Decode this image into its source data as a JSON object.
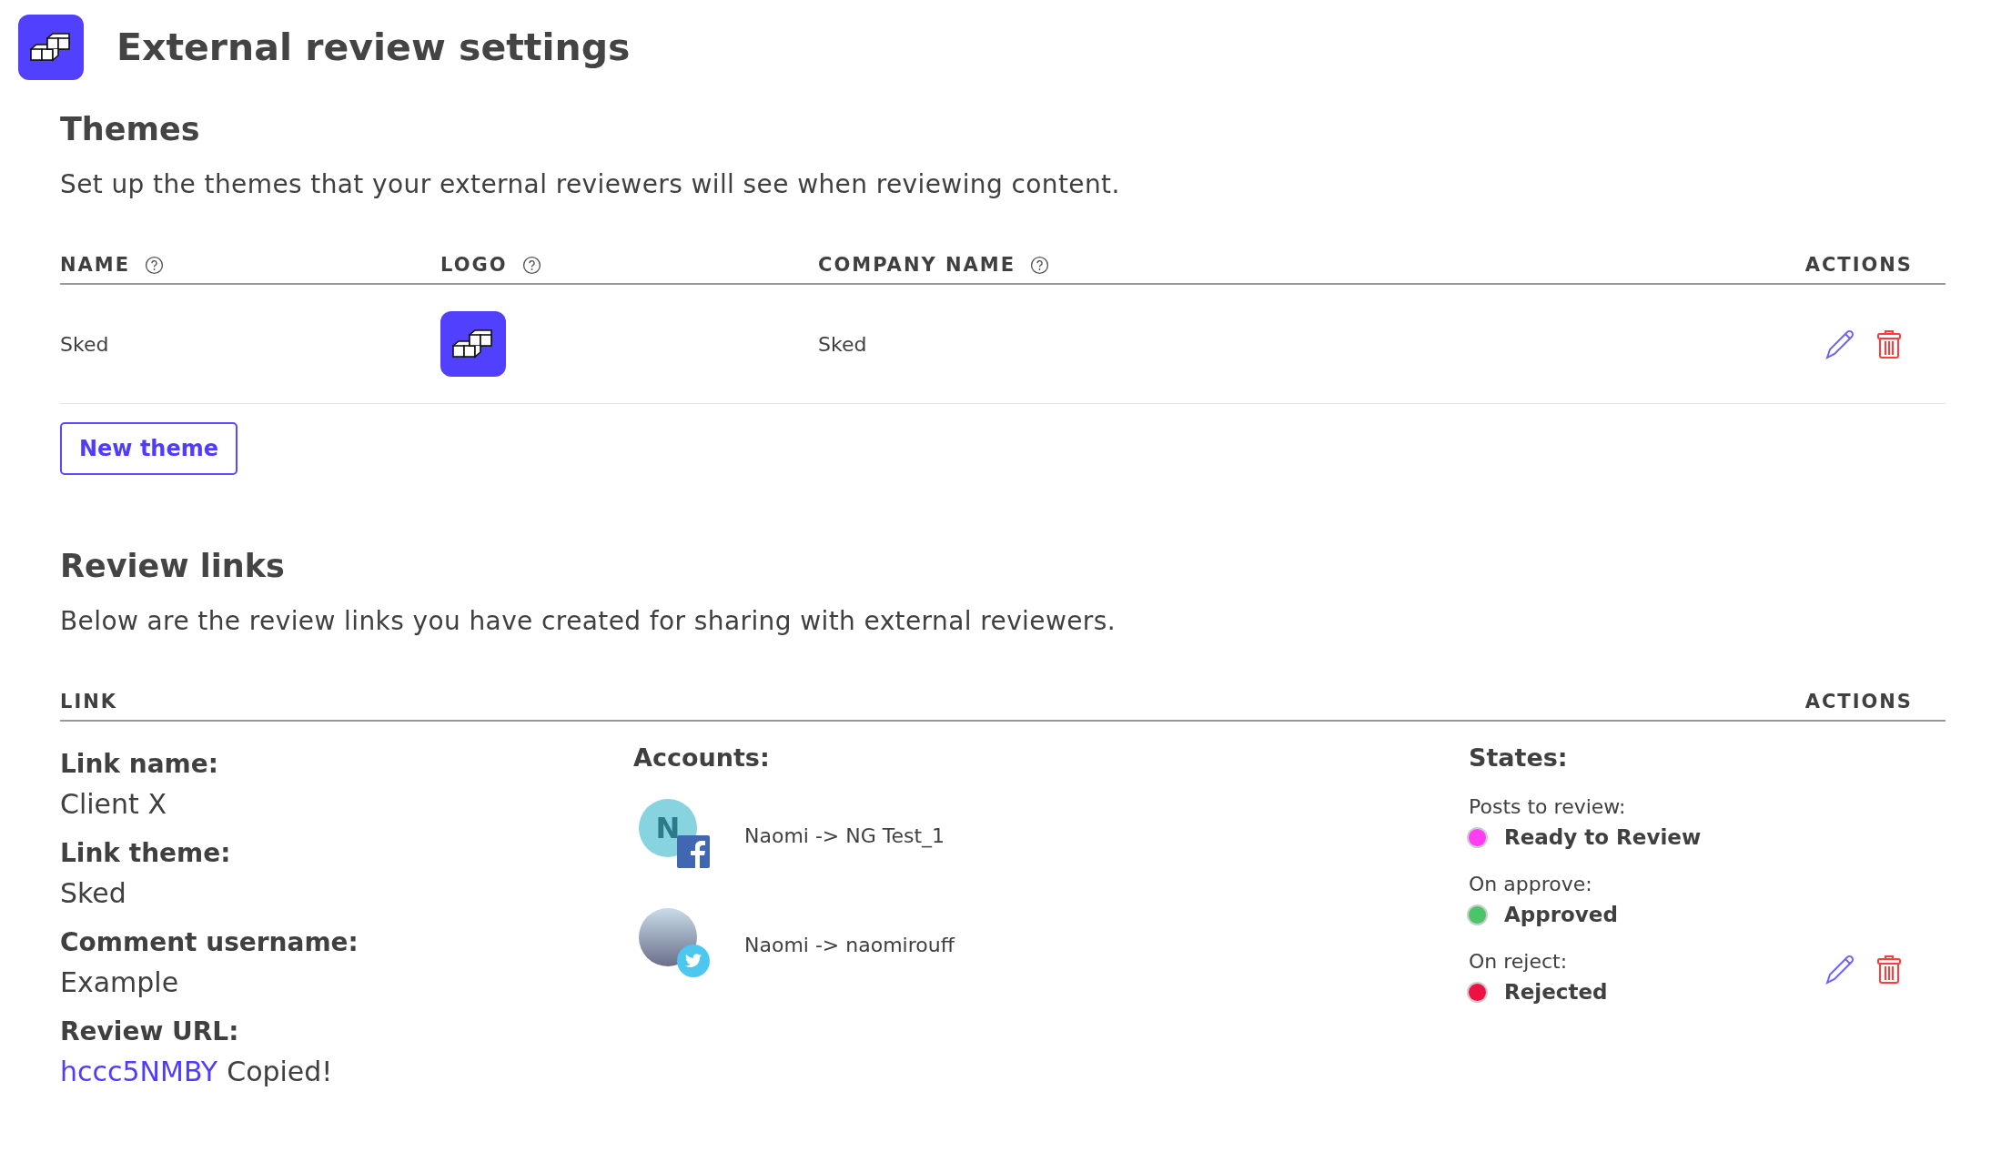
{
  "page": {
    "title": "External review settings"
  },
  "themes": {
    "title": "Themes",
    "description": "Set up the themes that your external reviewers will see when reviewing content.",
    "columns": [
      {
        "label": "NAME",
        "help": true
      },
      {
        "label": "LOGO",
        "help": true
      },
      {
        "label": "COMPANY NAME",
        "help": true
      },
      {
        "label": "ACTIONS",
        "help": false
      }
    ],
    "rows": [
      {
        "name": "Sked",
        "company_name": "Sked"
      }
    ],
    "new_button": "New theme"
  },
  "review_links": {
    "title": "Review links",
    "description": "Below are the review links you have created for sharing with external reviewers.",
    "columns": [
      {
        "label": "LINK"
      },
      {
        "label": "ACTIONS"
      }
    ],
    "links": [
      {
        "fields": [
          {
            "label": "Link name:",
            "value": "Client X"
          },
          {
            "label": "Link theme:",
            "value": "Sked"
          },
          {
            "label": "Comment username:",
            "value": "Example"
          }
        ],
        "url_label": "Review URL:",
        "url": "hccc5NMBY",
        "url_status": "Copied!",
        "accounts_label": "Accounts:",
        "accounts": [
          {
            "kind": "facebook",
            "initial": "N",
            "text": "Naomi -> NG Test_1"
          },
          {
            "kind": "twitter",
            "text": "Naomi -> naomirouff"
          }
        ],
        "states_label": "States:",
        "states": [
          {
            "label": "Posts to review:",
            "state": "Ready to Review",
            "color": "#ff3df2"
          },
          {
            "label": "On approve:",
            "state": "Approved",
            "color": "#4cc46a"
          },
          {
            "label": "On reject:",
            "state": "Rejected",
            "color": "#ee1144"
          }
        ]
      }
    ]
  }
}
